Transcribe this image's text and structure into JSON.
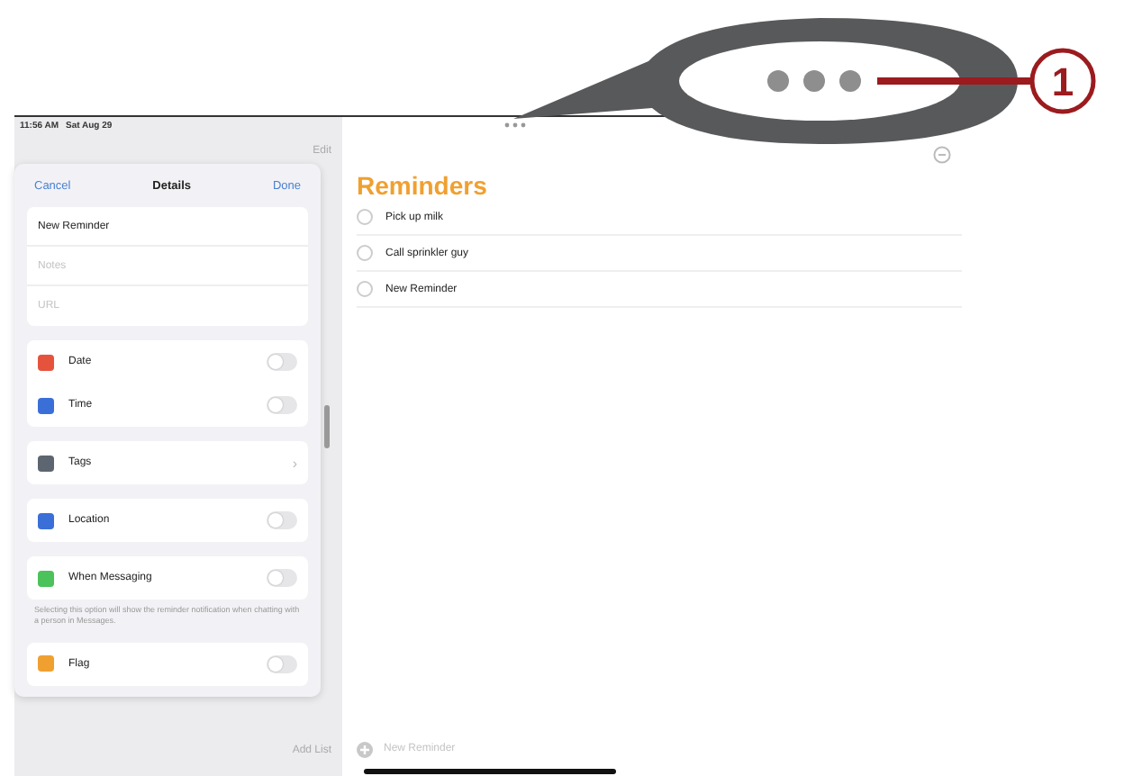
{
  "status_bar": {
    "time": "11:56 AM",
    "date": "Sat Aug 29"
  },
  "sidebar": {
    "edit": "Edit",
    "add_list": "Add List"
  },
  "details": {
    "cancel": "Cancel",
    "title": "Details",
    "done": "Done",
    "title_value": "New Reminder",
    "notes_placeholder": "Notes",
    "url_placeholder": "URL",
    "groups": [
      {
        "rows": [
          {
            "kind": "toggle",
            "label": "Date",
            "color": "#e5533d",
            "on": false
          },
          {
            "kind": "toggle",
            "label": "Time",
            "color": "#3a6fd8",
            "on": false
          }
        ]
      },
      {
        "rows": [
          {
            "kind": "disclosure",
            "label": "Tags",
            "color": "#5d6570",
            "chevron": "›"
          }
        ]
      },
      {
        "rows": [
          {
            "kind": "toggle",
            "label": "Location",
            "color": "#3a6fd8",
            "on": false
          }
        ]
      },
      {
        "rows": [
          {
            "kind": "toggle",
            "label": "When Messaging",
            "color": "#4cc25a",
            "on": false
          }
        ],
        "footer": "Selecting this option will show the reminder notification when chatting with a person in Messages."
      },
      {
        "rows": [
          {
            "kind": "toggle",
            "label": "Flag",
            "color": "#f0a030",
            "on": false
          }
        ]
      }
    ]
  },
  "list": {
    "title": "Reminders",
    "items": [
      {
        "text": "Pick up milk",
        "checked": false
      },
      {
        "text": "Call sprinkler guy",
        "checked": false
      },
      {
        "text": "New Reminder",
        "checked": false
      }
    ],
    "new_reminder": "New Reminder"
  },
  "callout": {
    "number": "1"
  }
}
